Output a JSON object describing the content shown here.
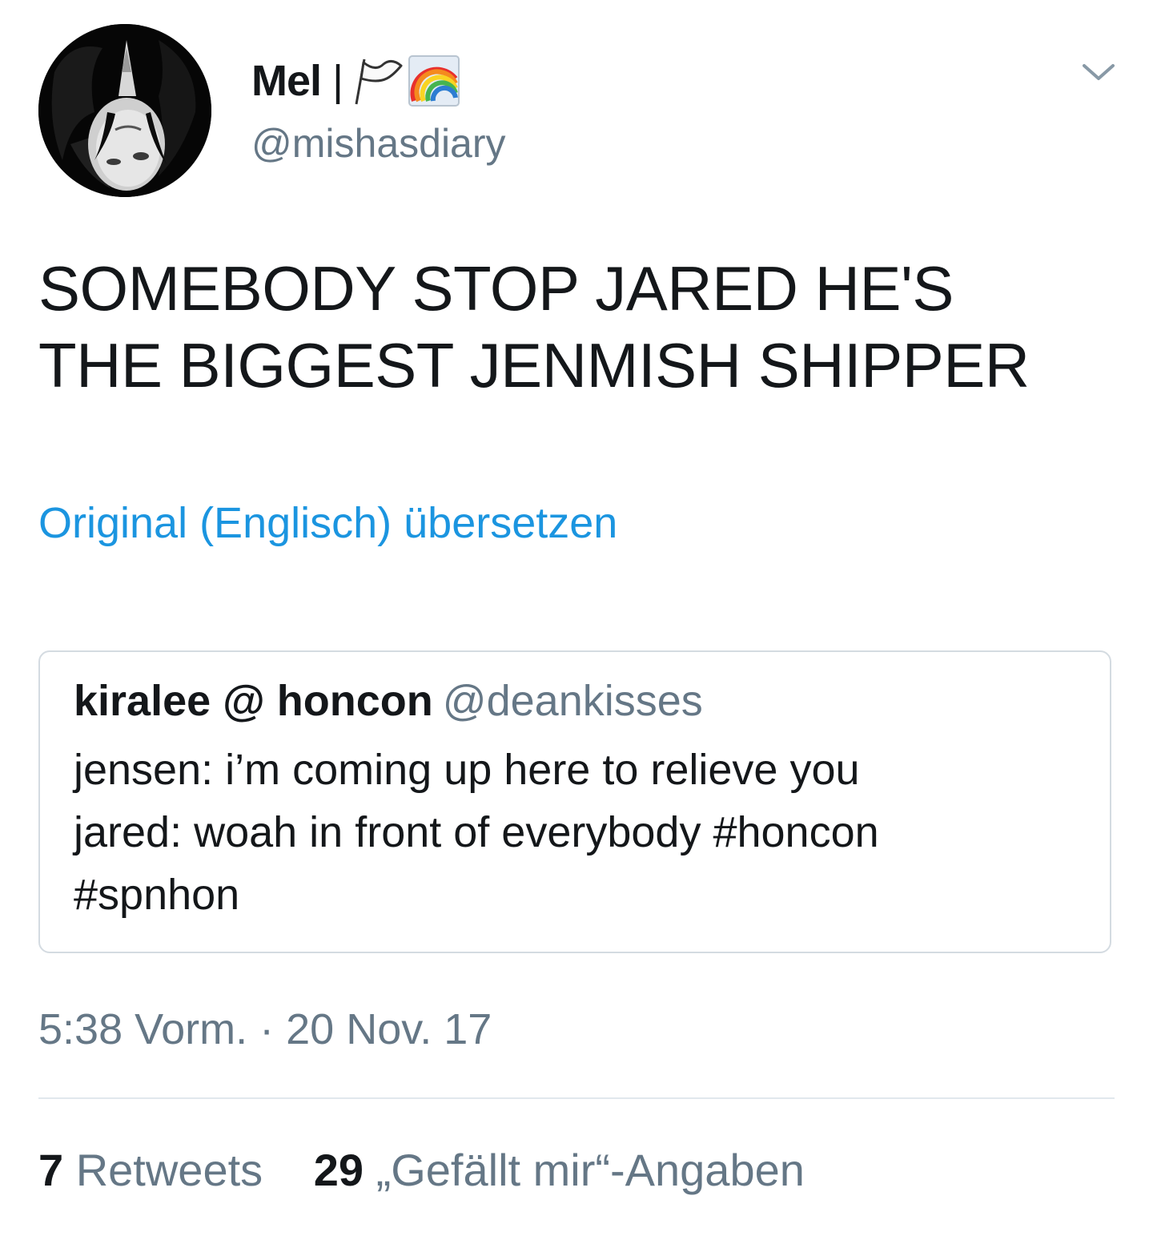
{
  "tweet": {
    "author_name": "Mel",
    "name_separator": "|",
    "name_icons": [
      "flag-icon",
      "rainbow-icon"
    ],
    "handle": "@mishasdiary",
    "text_line1": "SOMEBODY STOP JARED HE'S",
    "text_line2": "THE BIGGEST JENMISH SHIPPER",
    "translate_label": "Original (Englisch) übersetzen",
    "quoted": {
      "name": "kiralee @ honcon",
      "handle": "@deankisses",
      "line1": "jensen: i’m coming up here to relieve you",
      "line2": "jared: woah in front of everybody #honcon",
      "line3": "#spnhon"
    },
    "timestamp": "5:38 Vorm. · 20 Nov. 17",
    "retweets_count": "7",
    "retweets_label": "Retweets",
    "likes_count": "29",
    "likes_label": "„Gefällt mir“-Angaben"
  },
  "colors": {
    "text": "#14171a",
    "secondary": "#657786",
    "link": "#1b95e0",
    "border": "#d4dbe1"
  }
}
